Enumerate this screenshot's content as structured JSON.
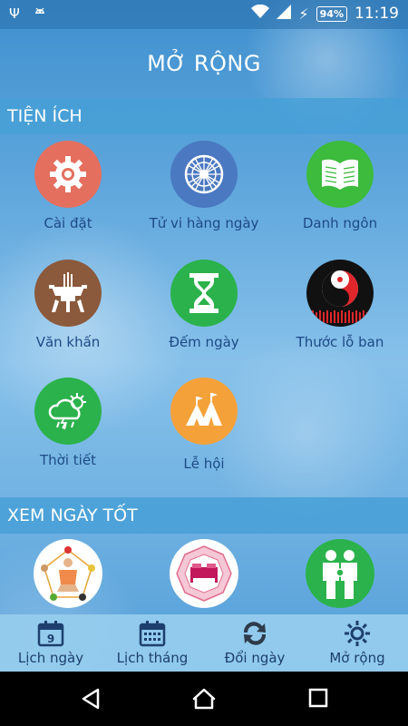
{
  "status": {
    "battery": "94%",
    "time": "11:19"
  },
  "header": {
    "title": "MỞ RỘNG"
  },
  "sections": {
    "tien_ich": "TIỆN ÍCH",
    "xem_ngay_tot": "XEM NGÀY TỐT"
  },
  "utilities": [
    {
      "label": "Cài đặt",
      "icon": "gear-icon",
      "color": "#e46f5e"
    },
    {
      "label": "Tử vi hàng ngày",
      "icon": "zodiac-wheel-icon",
      "color": "#4a78c1"
    },
    {
      "label": "Danh ngôn",
      "icon": "book-icon",
      "color": "#3dbb3d"
    },
    {
      "label": "Văn khấn",
      "icon": "incense-altar-icon",
      "color": "#8b5a3c"
    },
    {
      "label": "Đếm ngày",
      "icon": "hourglass-icon",
      "color": "#2bb24c"
    },
    {
      "label": "Thước lỗ ban",
      "icon": "yin-yang-ruler-icon",
      "color": "#111111"
    },
    {
      "label": "Thời tiết",
      "icon": "weather-icon",
      "color": "#2bb24c"
    },
    {
      "label": "Lễ hội",
      "icon": "festival-tent-icon",
      "color": "#f5a13a"
    }
  ],
  "good_days": [
    {
      "icon": "fengshui-person-icon"
    },
    {
      "icon": "bed-compass-icon"
    },
    {
      "icon": "family-icon"
    }
  ],
  "bottom_nav": {
    "day": {
      "label": "Lịch ngày",
      "badge": "9"
    },
    "month": {
      "label": "Lịch tháng"
    },
    "convert": {
      "label": "Đổi ngày"
    },
    "more": {
      "label": "Mở rộng"
    }
  }
}
